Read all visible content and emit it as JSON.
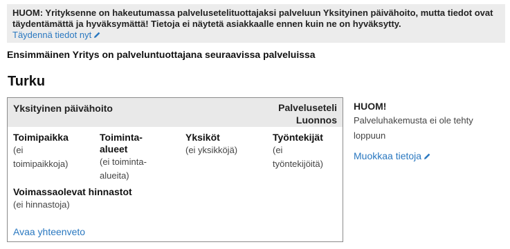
{
  "notice": {
    "text": "HUOM: Yrityksenne on hakeutumassa palveluseteli­tuottajaksi palveluun Yksityinen päivähoito, mutta tiedot ovat täydentämättä ja hyväksymättä! Tietoja ei näytetä asiakkaalle ennen kuin ne on hyväksytty.",
    "link_label": "Täydennä tiedot nyt",
    "link_icon": "pencil-icon"
  },
  "intro": "Ensimmäinen Yritys on palveluntuottajana seuraavissa palveluissa",
  "city": "Turku",
  "service": {
    "name": "Yksityinen päivähoito",
    "type_line1": "Palveluseteli",
    "type_line2": "Luonnos",
    "columns": [
      {
        "title": "Toimipaikka",
        "empty": "(ei\ntoimipaikkoja)"
      },
      {
        "title": "Toiminta-\nalueet",
        "empty": "(ei toiminta-\nalueita)"
      },
      {
        "title": "Yksiköt",
        "empty": "(ei yksikköjä)"
      },
      {
        "title": "Työntekijät",
        "empty": "(ei\ntyöntekijöitä)"
      }
    ],
    "pricelists_title": "Voimassaolevat hinnastot",
    "pricelists_empty": "(ei hinnastoja)",
    "summary_link": "Avaa yhteenveto"
  },
  "side": {
    "title": "HUOM!",
    "text": "Palveluhakemusta ei ole tehty loppuun",
    "edit_link": "Muokkaa tietoja",
    "edit_icon": "pencil-icon"
  },
  "colors": {
    "link": "#2a78c0",
    "notice_bg": "#ececec",
    "header_bg": "#e9e9e9"
  }
}
